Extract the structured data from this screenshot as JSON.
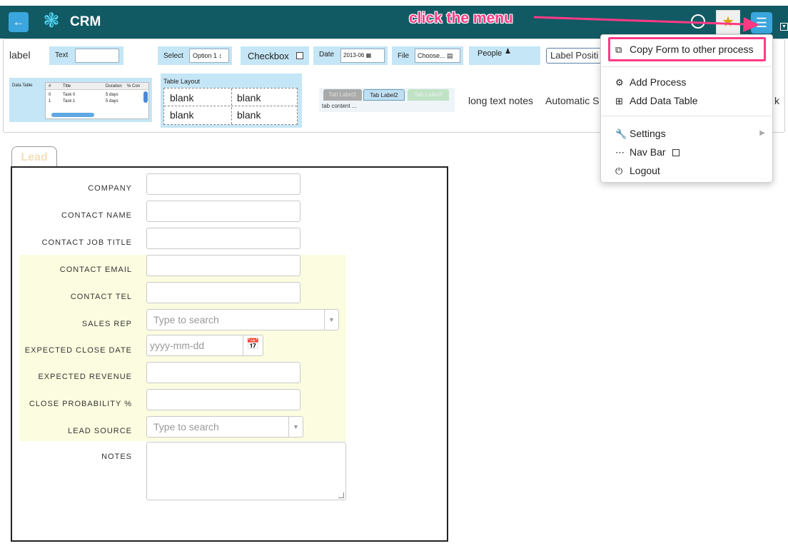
{
  "app": {
    "title": "CRM"
  },
  "annotation": {
    "text": "click the menu"
  },
  "toolbox": {
    "label": "label",
    "text_widget": "Text",
    "select_widget": "Select",
    "select_option": "Option 1",
    "checkbox_widget": "Checkbox",
    "date_widget": "Date",
    "date_value": "2013-06",
    "file_widget": "File",
    "file_button": "Choose...",
    "people_widget": "People",
    "label_position": "Label Positi",
    "data_table": {
      "title": "Data Table",
      "headers": [
        "#",
        "Title",
        "Duration",
        "% Con"
      ],
      "rows": [
        [
          "0",
          "Task 0",
          "5 days"
        ],
        [
          "1",
          "Task 1",
          "5 days"
        ]
      ]
    },
    "table_layout": {
      "title": "Table Layout",
      "cells": [
        "blank",
        "blank",
        "blank",
        "blank"
      ]
    },
    "tabs_widget": {
      "tabs": [
        "Tab Label1",
        "Tab Label2",
        "Tab Label3"
      ],
      "content": "tab content ..."
    },
    "long_text": "long text notes",
    "automatic": "Automatic S",
    "clipped_end": "k"
  },
  "form": {
    "tab_label": "Lead",
    "fields": {
      "company": "COMPANY",
      "contact_name": "CONTACT NAME",
      "contact_job_title": "CONTACT JOB TITLE",
      "contact_email": "CONTACT EMAIL",
      "contact_tel": "CONTACT TEL",
      "sales_rep": "SALES REP",
      "expected_close_date": "EXPECTED CLOSE DATE",
      "expected_revenue": "EXPECTED REVENUE",
      "close_probability": "CLOSE PROBABILITY %",
      "lead_source": "LEAD SOURCE",
      "notes": "NOTES"
    },
    "placeholders": {
      "sales_rep": "Type to search",
      "date": "yyyy-mm-dd",
      "lead_source": "Type to search"
    }
  },
  "menu": {
    "copy_form": "Copy Form to other process",
    "add_process": "Add Process",
    "add_data_table": "Add Data Table",
    "settings": "Settings",
    "nav_bar": "Nav Bar",
    "logout": "Logout"
  },
  "colors": {
    "topbar": "#115a63",
    "accent": "#3aa6dd",
    "annotation": "#ff3a85",
    "highlight_zone": "#fcfde0"
  }
}
